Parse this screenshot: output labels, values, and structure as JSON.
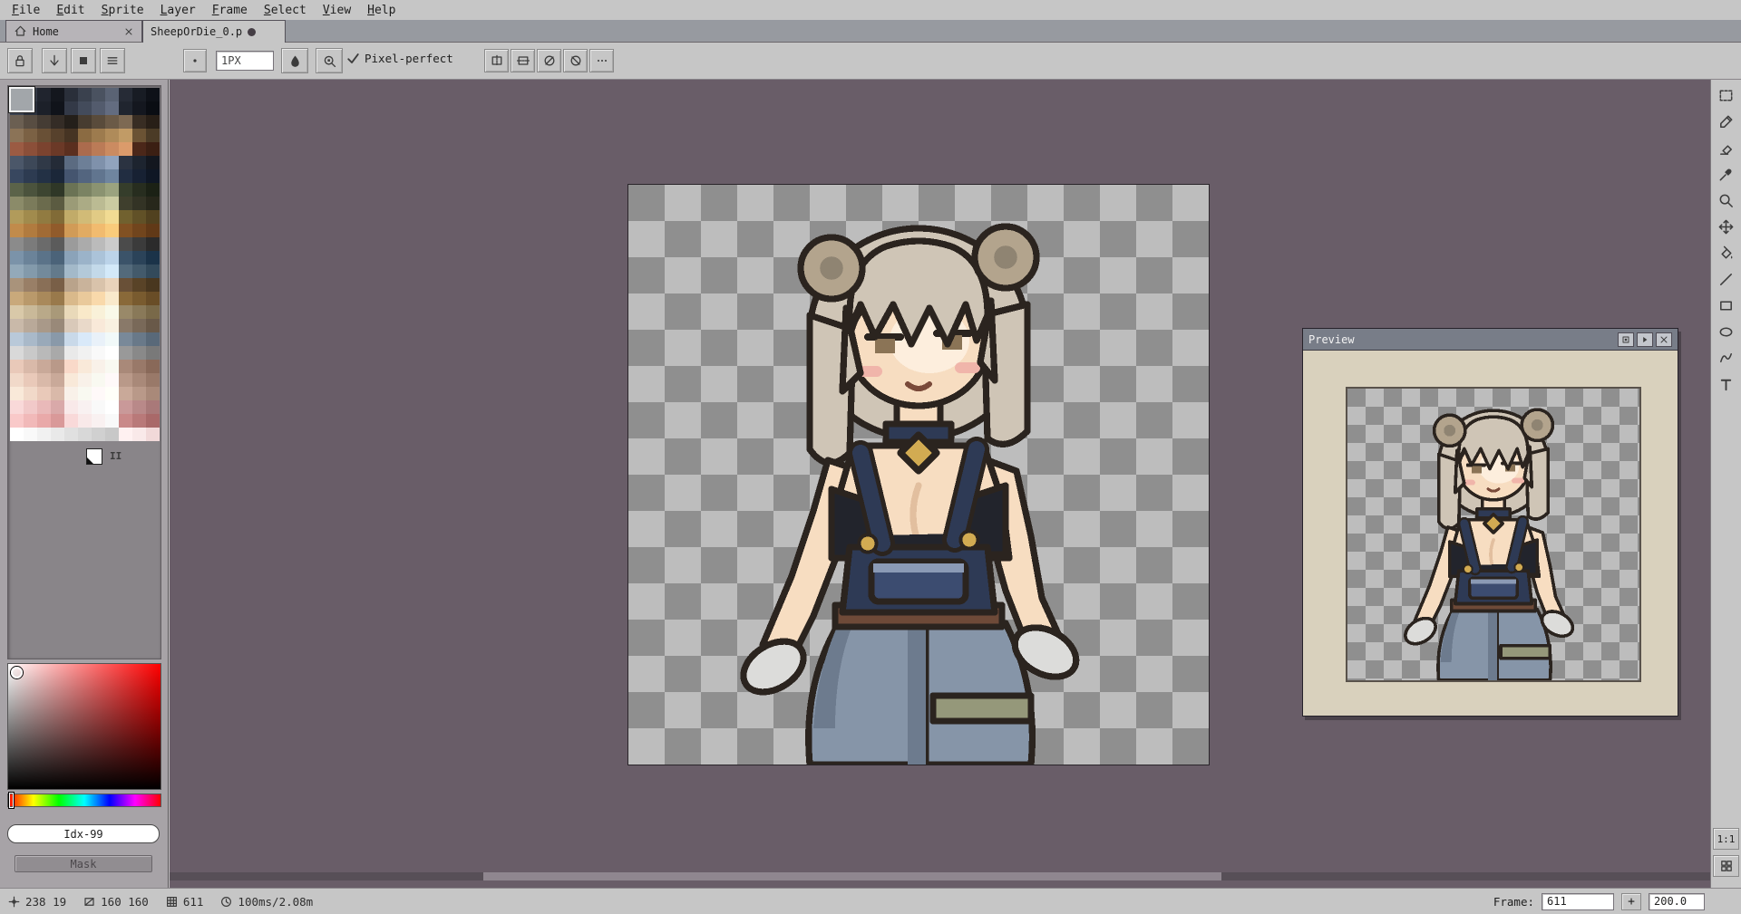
{
  "menu": {
    "items": [
      "File",
      "Edit",
      "Sprite",
      "Layer",
      "Frame",
      "Select",
      "View",
      "Help"
    ]
  },
  "tabs": {
    "home": {
      "label": "Home",
      "icon": "home",
      "close_icon": "close"
    },
    "doc": {
      "label": "SheepOrDie_0.p",
      "modified": true
    }
  },
  "toolbar_left_buttons": [
    "lock",
    "sort-down",
    "swatch",
    "list"
  ],
  "context_bar": {
    "brush_button_icon": "brush-dot",
    "brush_size": "1PX",
    "ink_icon": "ink",
    "zoom_icon": "zoom-tool",
    "check_icon": "check",
    "pixel_perfect": "Pixel-perfect",
    "symmetry_buttons": [
      "symmetry-vertical",
      "symmetry-horizontal",
      "symmetry-both",
      "symmetry-diagonal",
      "more"
    ]
  },
  "palette": {
    "columns": 11,
    "selected_color": "#a2a6aa",
    "rows": [
      [
        "#4a505c",
        "#343a46",
        "#20242e",
        "#14171e",
        "#2a2f3a",
        "#3a414e",
        "#4a5260",
        "#5a6374",
        "#262b36",
        "#181c24",
        "#0e1118"
      ],
      [
        "#3c4350",
        "#2a303c",
        "#1c2029",
        "#10131a",
        "#333947",
        "#434b5b",
        "#535b6d",
        "#636c80",
        "#20252f",
        "#14171f",
        "#0a0d13"
      ],
      [
        "#6b5f52",
        "#584d42",
        "#453c34",
        "#342c26",
        "#241f1a",
        "#473c30",
        "#594b3b",
        "#6b5a47",
        "#7d6953",
        "#382d23",
        "#281f17"
      ],
      [
        "#8b7357",
        "#7b6144",
        "#695036",
        "#57412c",
        "#463423",
        "#8b6b42",
        "#9d7b4e",
        "#af8b5a",
        "#c19b66",
        "#6b5334",
        "#4b3b26"
      ],
      [
        "#9b5b43",
        "#8b4f39",
        "#7b432f",
        "#6b3927",
        "#5b2f1f",
        "#ab6b4d",
        "#bb7b57",
        "#cb8b61",
        "#db9b6b",
        "#4b2719",
        "#3b1f13"
      ],
      [
        "#4b5769",
        "#3d4858",
        "#303947",
        "#242b37",
        "#5b6b81",
        "#6d7f97",
        "#7f91ab",
        "#91a3bd",
        "#2b3341",
        "#1d242f",
        "#13171f"
      ],
      [
        "#38475f",
        "#2d3b51",
        "#233145",
        "#1b2739",
        "#45556f",
        "#53657f",
        "#61758f",
        "#6f859f",
        "#212d41",
        "#172133",
        "#0f1725"
      ],
      [
        "#5b6349",
        "#4b533d",
        "#3d4531",
        "#2f3727",
        "#6b7355",
        "#7b8363",
        "#8b9371",
        "#9ba37f",
        "#353d2b",
        "#272d1f",
        "#1b2115"
      ],
      [
        "#8b8b69",
        "#7b7b5b",
        "#6b6b4d",
        "#5b5b41",
        "#9b9b77",
        "#abab85",
        "#bbbb93",
        "#cbcba1",
        "#3f3f2d",
        "#333325",
        "#27271b"
      ],
      [
        "#b19b5b",
        "#a18b4d",
        "#917b41",
        "#816b37",
        "#c1ab69",
        "#d1bb77",
        "#e1cb85",
        "#f1db93",
        "#71612f",
        "#615127",
        "#51411f"
      ],
      [
        "#c18b4b",
        "#b17b3f",
        "#a16b35",
        "#915b2b",
        "#d19b57",
        "#e1ab63",
        "#f1bb6f",
        "#f9cb7b",
        "#815123",
        "#71451d",
        "#613917"
      ],
      [
        "#8b8b8b",
        "#7b7b7b",
        "#6b6b6b",
        "#5b5b5b",
        "#9b9b9b",
        "#ababab",
        "#bbbbbb",
        "#cbcbcb",
        "#4b4b4b",
        "#3b3b3b",
        "#2b2b2b"
      ],
      [
        "#7b93a9",
        "#6b8399",
        "#5b7389",
        "#4b6379",
        "#8ba3b9",
        "#9bb3c9",
        "#abc3d9",
        "#bbd3e9",
        "#3b5369",
        "#2b4359",
        "#1b3349"
      ],
      [
        "#93a9b9",
        "#839aab",
        "#738a9b",
        "#637a8b",
        "#a3b9c9",
        "#b3c9d9",
        "#c3d9e9",
        "#d3e9f9",
        "#536a7b",
        "#435a6b",
        "#334a5b"
      ],
      [
        "#a9937b",
        "#997f67",
        "#896f57",
        "#795f47",
        "#b9a38b",
        "#c9b39b",
        "#d9c3ab",
        "#e9d3bb",
        "#695037",
        "#594327",
        "#49371f"
      ],
      [
        "#c9a97b",
        "#b9996b",
        "#a9895b",
        "#99794b",
        "#d9b98b",
        "#e9c99b",
        "#f9d9ab",
        "#f9e9cb",
        "#896939",
        "#795b2f",
        "#694d27"
      ],
      [
        "#d9c9a9",
        "#c9b999",
        "#b9a989",
        "#a99979",
        "#e9d9b9",
        "#f9e9c9",
        "#f9f1d9",
        "#f9f9e9",
        "#998969",
        "#897959",
        "#796949"
      ],
      [
        "#c9b9a9",
        "#b9a999",
        "#a99989",
        "#998979",
        "#d9c9b9",
        "#e9d9c9",
        "#f9e9d9",
        "#f9f1e1",
        "#897969",
        "#796959",
        "#695949"
      ],
      [
        "#b9c9d9",
        "#a9b9c9",
        "#99a9b9",
        "#8999a9",
        "#c9d9e9",
        "#d9e9f9",
        "#e9f1f9",
        "#f1f9f9",
        "#798999",
        "#697989",
        "#596979"
      ],
      [
        "#d9d9d9",
        "#c9c9c9",
        "#b9b9b9",
        "#a9a9a9",
        "#e9e9e9",
        "#f1f1f1",
        "#f9f9f9",
        "#ffffff",
        "#999999",
        "#898989",
        "#797979"
      ],
      [
        "#e9c9b9",
        "#d9b9a9",
        "#c9a999",
        "#b99989",
        "#f9d9c9",
        "#f9e9d9",
        "#f9f1e9",
        "#f9f9f1",
        "#a98979",
        "#997969",
        "#896959"
      ],
      [
        "#f1d9c9",
        "#e9c9b9",
        "#d9b9a9",
        "#c9a999",
        "#f9e9d9",
        "#f9f1e9",
        "#f9f9f1",
        "#fff9f9",
        "#b99989",
        "#a98979",
        "#997969"
      ],
      [
        "#f9e9d9",
        "#f1d9c9",
        "#e9c9b9",
        "#d9b9a9",
        "#f9f1e9",
        "#f9f9f1",
        "#fff9f9",
        "#fffff9",
        "#c9a999",
        "#b99989",
        "#a98979"
      ],
      [
        "#f9d9d9",
        "#f1c9c9",
        "#e9b9b9",
        "#d9a9a9",
        "#f9e9e9",
        "#f9f1f1",
        "#f9f9f9",
        "#ffffff",
        "#c99999",
        "#b98989",
        "#a97979"
      ],
      [
        "#f9c9c9",
        "#f1b9b9",
        "#e9a9a9",
        "#d99999",
        "#f9d9d9",
        "#f9e9e9",
        "#f9f1f1",
        "#f9f9f9",
        "#c98989",
        "#b97979",
        "#a96969"
      ],
      [
        "#ffffff",
        "#f9f9f9",
        "#f1f1f1",
        "#e9e9e9",
        "#e0e0e0",
        "#d8d8d8",
        "#d0d0d0",
        "#c8c8c8",
        "#fff1f1",
        "#f9e9e9",
        "#f1d9d9"
      ]
    ]
  },
  "left_panel": {
    "index_label": "Idx-99",
    "mask_label": "Mask",
    "fg_marker": "II"
  },
  "right_toolbar": {
    "tools": [
      "rect-marquee",
      "pencil",
      "eraser",
      "eyedropper",
      "zoom",
      "move",
      "paint-bucket",
      "line",
      "rectangle",
      "ellipse",
      "contour",
      "text"
    ],
    "ratio_label": "1:1",
    "tiles_icon": "tiles"
  },
  "preview": {
    "title": "Preview",
    "buttons": [
      "prev-restore",
      "prev-play",
      "close"
    ]
  },
  "status": {
    "items": [
      {
        "icon": "crosshair",
        "text": "238 19"
      },
      {
        "icon": "size-rect",
        "text": "160 160"
      },
      {
        "icon": "frames",
        "text": "611"
      },
      {
        "icon": "clock",
        "text": "100ms/2.08m"
      }
    ],
    "frame_label": "Frame:",
    "frame_value": "611",
    "plus_label": "+",
    "zoom_value": "200.0"
  },
  "colors": {
    "ui": "#c6c6c6",
    "canvas_bg": "#695d68",
    "checker_light": "#bdbdbd",
    "checker_dark": "#8f8f8f",
    "titlebar": "#787d88",
    "preview_body": "#d9d1bd"
  },
  "sprite": {
    "subject": "pixel-art sheep girl in denim overalls on transparent checkerboard",
    "colors": {
      "outline": "#2b241f",
      "hair": "#cfc5b6",
      "hairsh": "#b3a795",
      "horn": "#b3a48d",
      "horn2": "#8f8472",
      "skin": "#f7ddc1",
      "skinsh": "#e2bf9f",
      "skinhi": "#fdeedd",
      "eye": "#8b7456",
      "blush": "#f0b5aa",
      "mouth": "#7a4a3a",
      "black": "#22242c",
      "navy": "#2e3a55",
      "navy2": "#3c4c70",
      "navyhi": "#8b9ab5",
      "belt": "#6e4a38",
      "jeans": "#8695a8",
      "jeanssh": "#6d7b8e",
      "band": "#95987a",
      "glove": "#dcdcda",
      "gold": "#d2ab52"
    }
  }
}
